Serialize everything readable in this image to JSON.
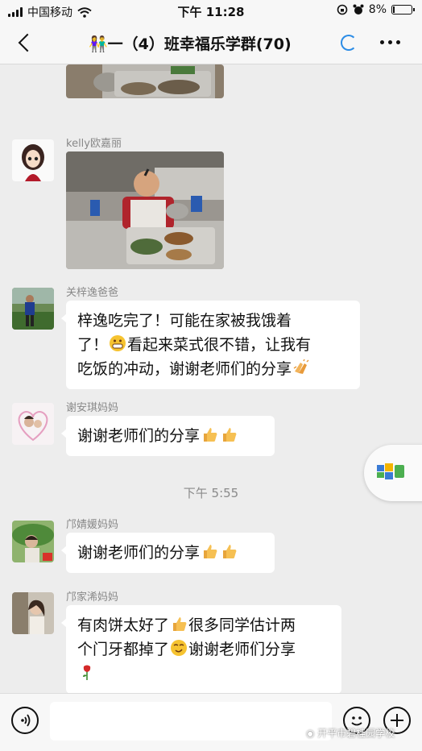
{
  "status_bar": {
    "carrier": "中国移动",
    "time": "下午 11:28",
    "battery": "8%",
    "icons": [
      "signal-icon",
      "wifi-icon",
      "orientation-lock-icon",
      "alarm-icon",
      "battery-icon"
    ]
  },
  "nav": {
    "title": "👫一（4）班幸福乐学群(70)",
    "back_icon": "chevron-left-icon",
    "more_icon": "more-icon"
  },
  "messages": [
    {
      "sender": "kelly欧嘉丽",
      "type": "image"
    },
    {
      "sender": "关梓逸爸爸",
      "lines": [
        "梓逸吃完了！可能在家被我饿着",
        "了！",
        "看起来菜式很不错，让我有",
        "吃饭的冲动，谢谢老师们的分享"
      ]
    },
    {
      "sender": "谢安琪妈妈",
      "text": "谢谢老师们的分享"
    },
    {
      "sender": "邝婧媛妈妈",
      "text": "谢谢老师们的分享"
    },
    {
      "sender": "邝家浠妈妈",
      "lines": [
        "有肉饼太好了",
        "很多同学估计两",
        "个门牙都掉了",
        "谢谢老师们分享"
      ]
    }
  ],
  "timestamp": "下午 5:55",
  "input_bar": {
    "voice_icon": "voice-icon",
    "emoji_icon": "emoji-icon",
    "plus_icon": "plus-icon"
  },
  "watermark": "开平市碧桂园学校",
  "colors": {
    "accent": "#2b8ce6",
    "background": "#ededed",
    "bubble": "#ffffff"
  }
}
